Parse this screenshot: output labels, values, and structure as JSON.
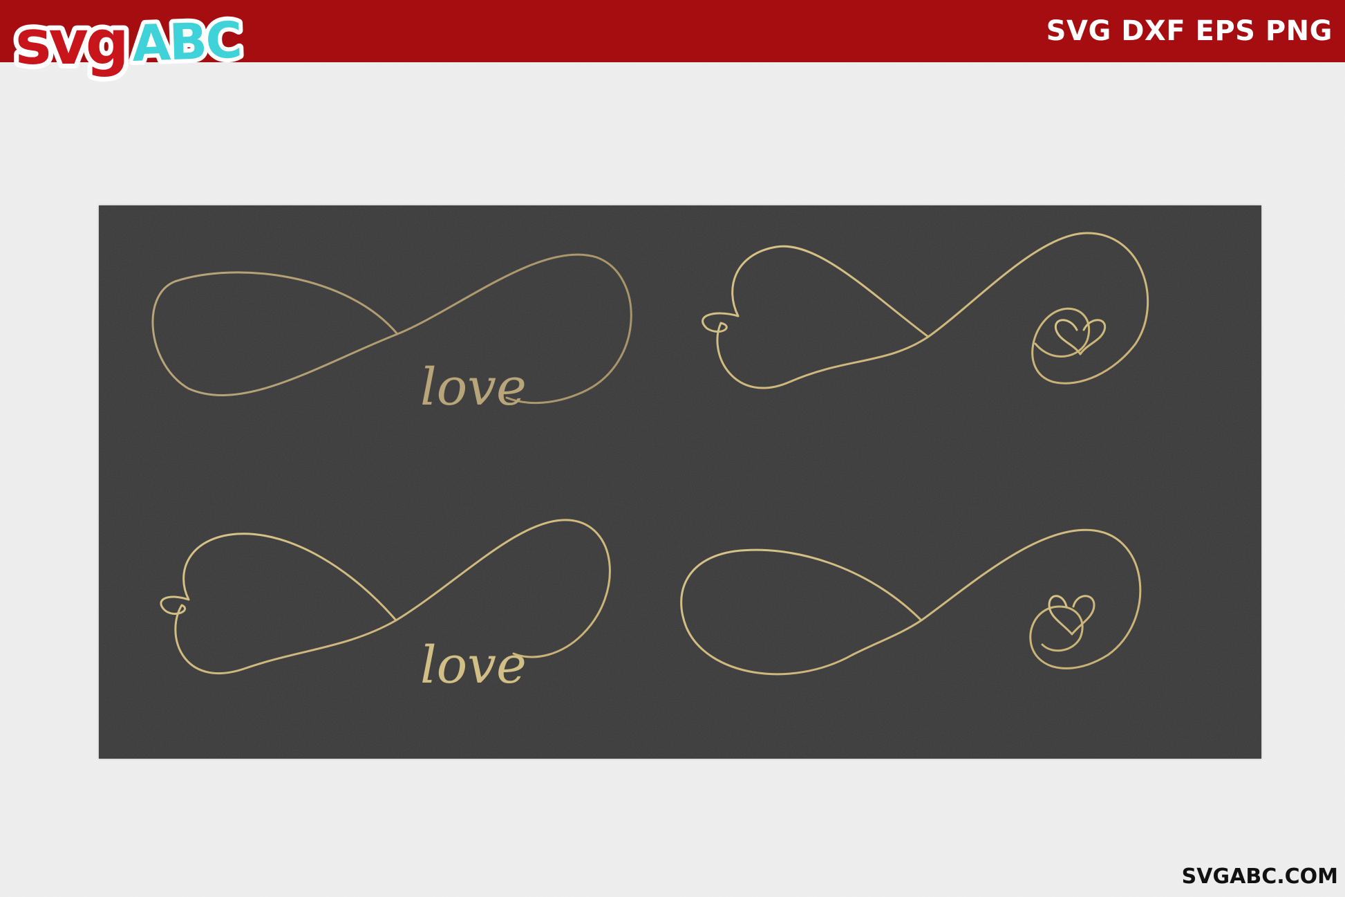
{
  "header": {
    "logo": {
      "part1": "svg",
      "part2": "ABC",
      "color_part1": "#c8141b",
      "color_part2": "#3fd3d9",
      "outline": "#ffffff"
    },
    "formats": "SVG DXF EPS PNG",
    "bar_color": "#a50d10"
  },
  "artwork": {
    "board_color": "#3a3a3a",
    "line_color": "#c9b57b",
    "items": [
      {
        "name": "infinity-love",
        "word": "love"
      },
      {
        "name": "infinity-heart-ends"
      },
      {
        "name": "infinity-heart-love",
        "word": "love"
      },
      {
        "name": "infinity-small-heart"
      }
    ]
  },
  "footer": {
    "url": "SVGABC.COM"
  }
}
